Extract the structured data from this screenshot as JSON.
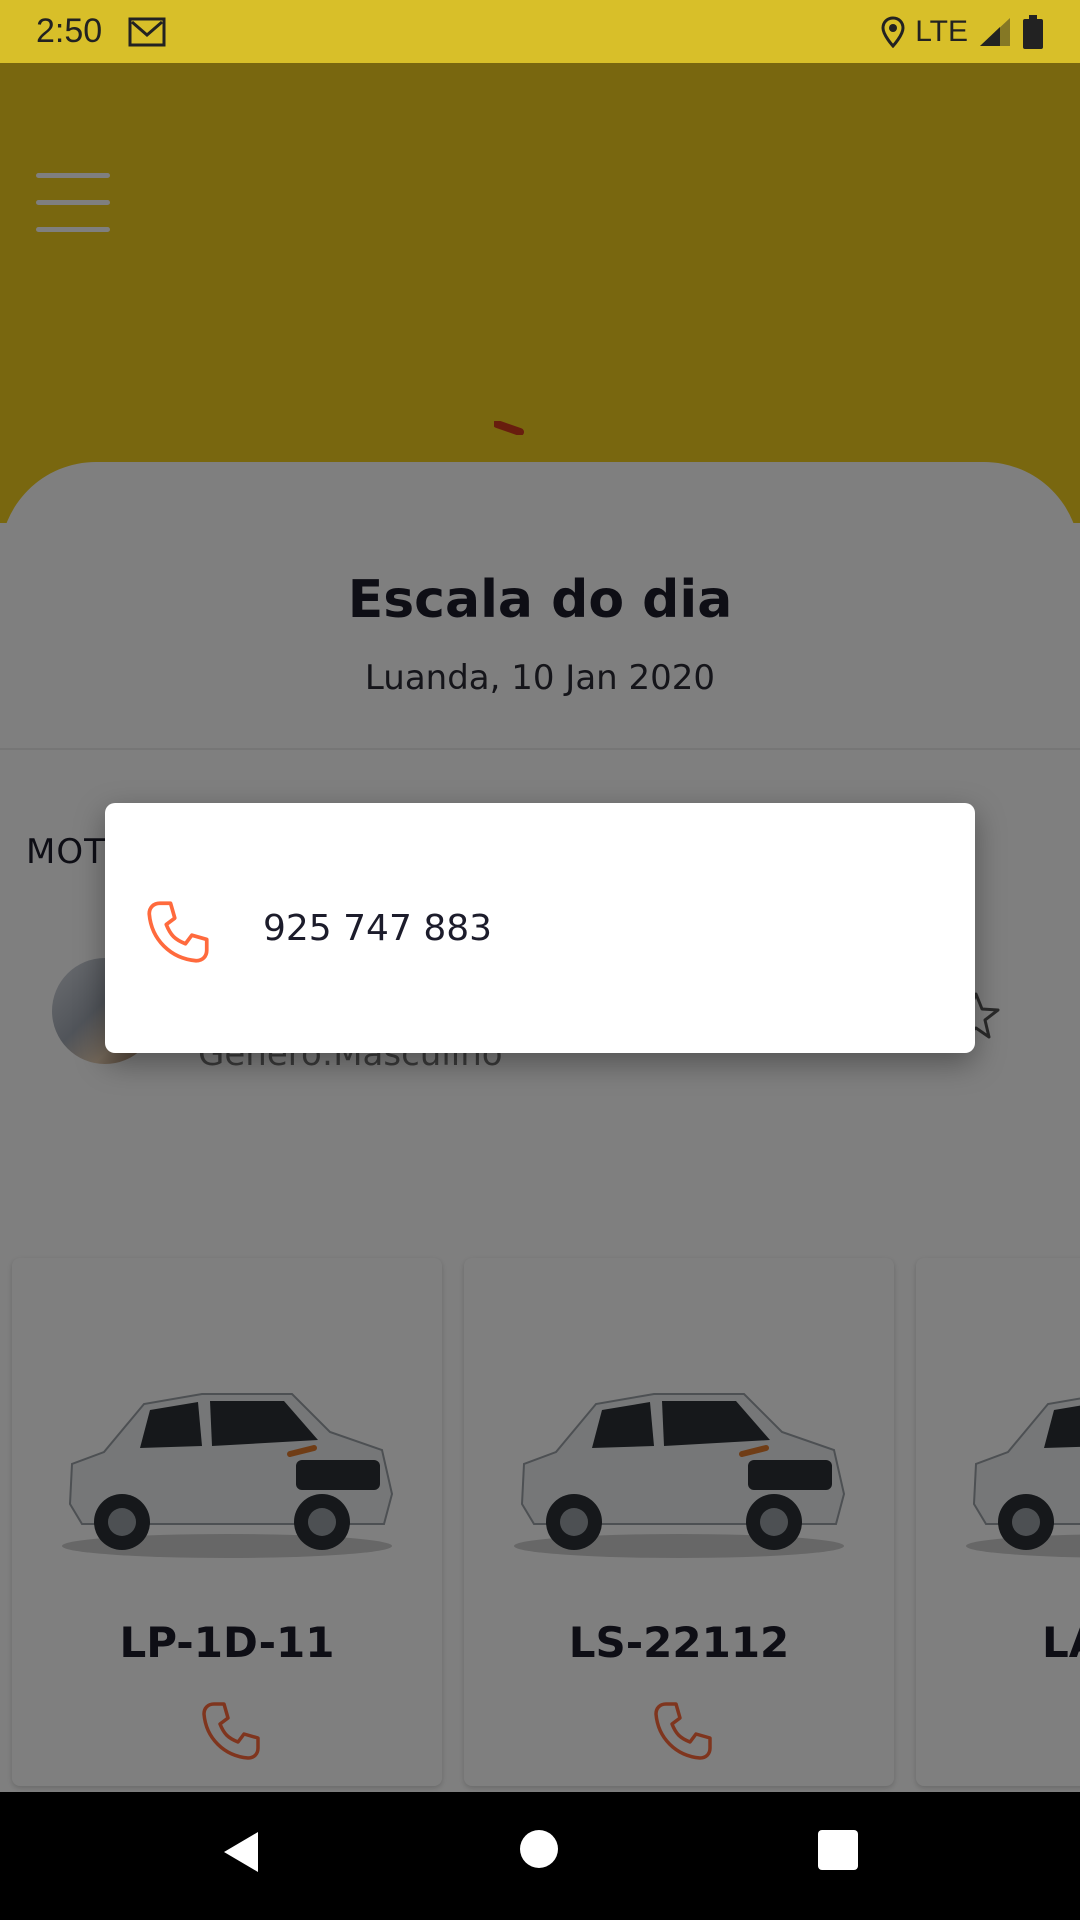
{
  "status_bar": {
    "time": "2:50",
    "network": "LTE",
    "icons": [
      "gmail-icon",
      "location-icon",
      "signal-icon",
      "battery-icon"
    ]
  },
  "header": {
    "menu_icon": "hamburger-menu-icon",
    "background_color": "#f2cf1e"
  },
  "schedule": {
    "title": "Escala do dia",
    "subtitle": "Luanda, 10 Jan 2020"
  },
  "driver": {
    "section_label": "MOT",
    "gender": "Genero:Masculino",
    "favorite_icon": "star-outline-icon"
  },
  "vehicles": [
    {
      "plate": "LP-1D-11",
      "call_icon": "phone-icon"
    },
    {
      "plate": "LS-22112",
      "call_icon": "phone-icon"
    },
    {
      "plate": "LA",
      "call_icon": "phone-icon"
    }
  ],
  "dialog": {
    "phone_number": "925 747 883",
    "icon": "phone-icon",
    "accent_color": "#ff6a3d"
  },
  "nav_bar": {
    "icons": [
      "back-icon",
      "home-icon",
      "recents-icon"
    ]
  }
}
